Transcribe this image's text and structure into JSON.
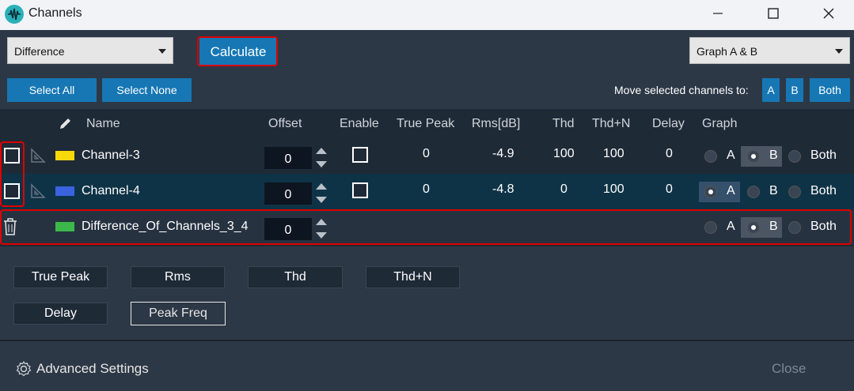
{
  "window": {
    "title": "Channels"
  },
  "toolbar": {
    "operation_select": "Difference",
    "calculate_label": "Calculate",
    "graph_select": "Graph A & B",
    "select_all_label": "Select All",
    "select_none_label": "Select None",
    "move_label": "Move selected channels to:",
    "move_a": "A",
    "move_b": "B",
    "move_both": "Both"
  },
  "table": {
    "headers": {
      "name": "Name",
      "offset": "Offset",
      "enable": "Enable",
      "true_peak": "True Peak",
      "rms": "Rms[dB]",
      "thd": "Thd",
      "thdn": "Thd+N",
      "delay": "Delay",
      "graph": "Graph"
    },
    "radio_labels": {
      "a": "A",
      "b": "B",
      "both": "Both"
    },
    "rows": [
      {
        "name": "Channel-3",
        "color": "#f5d90a",
        "offset": "0",
        "true_peak": "0",
        "rms": "-4.9",
        "thd": "100",
        "thdn": "100",
        "delay": "0",
        "graph": "B"
      },
      {
        "name": "Channel-4",
        "color": "#3b63e0",
        "offset": "0",
        "true_peak": "0",
        "rms": "-4.8",
        "thd": "0",
        "thdn": "100",
        "delay": "0",
        "graph": "A"
      },
      {
        "name": "Difference_Of_Channels_3_4",
        "color": "#3cb84a",
        "offset": "0",
        "graph": "B"
      }
    ]
  },
  "stats_buttons": {
    "true_peak": "True Peak",
    "rms": "Rms",
    "thd": "Thd",
    "thdn": "Thd+N",
    "delay": "Delay",
    "peak_freq": "Peak Freq"
  },
  "footer": {
    "advanced_settings": "Advanced Settings",
    "close": "Close"
  }
}
